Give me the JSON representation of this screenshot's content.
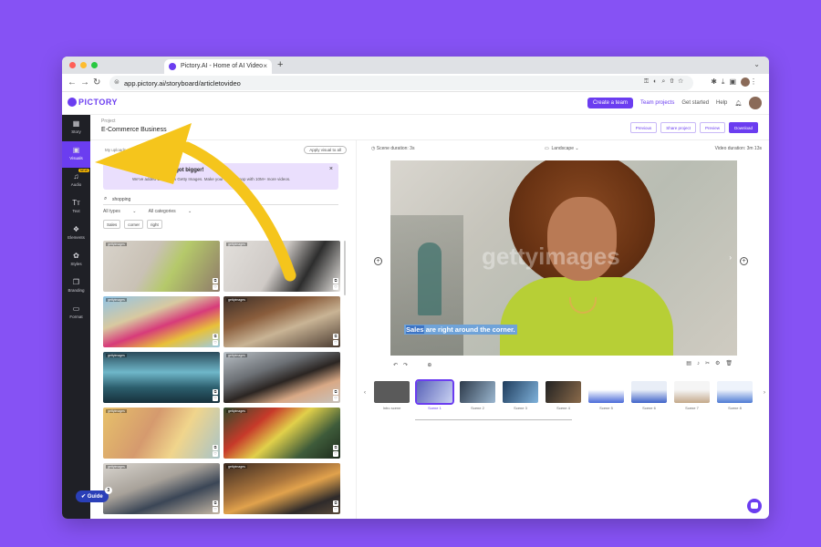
{
  "browser": {
    "tab_title": "Pictory.AI - Home of AI Video",
    "tab_close": "×",
    "new_tab": "+",
    "url": "app.pictory.ai/storyboard/articletovideo",
    "traffic_colors": [
      "#ff5f57",
      "#febc2e",
      "#28c840"
    ]
  },
  "app": {
    "logo": "PICTORY",
    "brand_color": "#6b3df0",
    "header": {
      "create_team": "Create a team",
      "team_projects": "Team projects",
      "get_started": "Get started",
      "help": "Help"
    }
  },
  "sidebar": {
    "items": [
      {
        "label": "Story",
        "icon": "grid-icon"
      },
      {
        "label": "Visuals",
        "icon": "image-icon",
        "active": true
      },
      {
        "label": "Audio",
        "icon": "music-icon",
        "badge": "NEW"
      },
      {
        "label": "Text",
        "icon": "text-icon"
      },
      {
        "label": "Elements",
        "icon": "elements-icon"
      },
      {
        "label": "Styles",
        "icon": "palette-icon"
      },
      {
        "label": "Branding",
        "icon": "branding-icon"
      },
      {
        "label": "Format",
        "icon": "format-icon"
      }
    ]
  },
  "project": {
    "label": "Project",
    "name": "E-Commerce Business",
    "buttons": {
      "previous": "Previous",
      "share": "Share project",
      "preview": "Preview",
      "download": "Download"
    }
  },
  "visuals": {
    "filters": {
      "my_uploads": "My uploads",
      "recent": "Recent",
      "apply": "Apply visual to all"
    },
    "banner": {
      "title": "Your library just got bigger!",
      "subtitle": "We've added 10M+ new Getty Images. Make your content pop with 10M+ more videos."
    },
    "search_value": "shopping",
    "type_select": "All types",
    "category_select": "All categories",
    "chips": [
      "Sales",
      "corner",
      "right"
    ],
    "thumbs": [
      {
        "wm": "gettyimages",
        "bg": "linear-gradient(120deg,#d8d3cb 0%,#c9c1b5 40%,#b5c96a 60%,#8f7a6a 100%)"
      },
      {
        "wm": "gettyimages",
        "bg": "linear-gradient(120deg,#e2dfdb 0%,#cfcac6 45%,#2d2d2d 70%,#e9e6e2 100%)"
      },
      {
        "wm": "gettyimages",
        "bg": "linear-gradient(160deg,#8fc3e6 0%,#d8c9a0 35%,#d73b7a 55%,#e8c13a 75%,#9ccbe5 100%)"
      },
      {
        "wm": "gettyimages",
        "bg": "linear-gradient(160deg,#3a2e28 0%,#8a5d3c 35%,#c9b495 60%,#4a3a30 100%)"
      },
      {
        "wm": "gettyimages",
        "bg": "linear-gradient(180deg,#2a4a5a 0%,#6fb7c9 40%,#2c5e6d 70%,#17313c 100%)"
      },
      {
        "wm": "gettyimages",
        "bg": "linear-gradient(160deg,#b9c0c6 0%,#6c7075 35%,#2b2522 55%,#d9a986 75%,#c7c2bd 100%)"
      },
      {
        "wm": "gettyimages",
        "bg": "linear-gradient(120deg,#e7c16a 0%,#d59a6e 40%,#f0d58c 65%,#a7c3c8 100%)"
      },
      {
        "wm": "gettyimages",
        "bg": "linear-gradient(140deg,#2f4a2c 0%,#c73a2a 30%,#e1d04a 50%,#3e5b3a 75%,#1d2a1b 100%)"
      },
      {
        "wm": "gettyimages",
        "bg": "linear-gradient(160deg,#d9d5cf 0%,#a8a29a 40%,#3b4656 65%,#c6b8a5 100%)"
      },
      {
        "wm": "gettyimages",
        "bg": "linear-gradient(160deg,#3b2a20 0%,#a9743c 40%,#e1a24c 55%,#2e2a2a 80%,#5a4a3a 100%)"
      }
    ]
  },
  "editor": {
    "scene_duration": "Scene duration: 3s",
    "orientation": "Landscape",
    "video_duration": "Video duration: 3m 13s",
    "caption_highlight": "Sales",
    "caption_rest": " are right around the corner.",
    "watermark": "gettyimages"
  },
  "timeline": {
    "scenes": [
      {
        "label": "Intro scene",
        "bg": "#5a5a5a"
      },
      {
        "label": "Scene 1",
        "bg": "linear-gradient(120deg,#5a63b8,#c9d2f2)",
        "active": true
      },
      {
        "label": "Scene 2",
        "bg": "linear-gradient(120deg,#2d3a4a,#9bb7d0)"
      },
      {
        "label": "Scene 3",
        "bg": "linear-gradient(120deg,#1f3c5c,#7fb2db)"
      },
      {
        "label": "Scene 4",
        "bg": "linear-gradient(120deg,#222,#8a6a4a)"
      },
      {
        "label": "Scene 5",
        "bg": "linear-gradient(180deg,#fff 40%,#4a6ad8 100%)"
      },
      {
        "label": "Scene 6",
        "bg": "linear-gradient(180deg,#e9eef7 40%,#3f63c9 100%)"
      },
      {
        "label": "Scene 7",
        "bg": "linear-gradient(180deg,#f5f5f5 40%,#c4a98a 100%)"
      },
      {
        "label": "Scene 8",
        "bg": "linear-gradient(180deg,#eef3fb 40%,#4e7bd4 100%)"
      }
    ]
  },
  "guide": {
    "label": "Guide",
    "count": "3"
  }
}
